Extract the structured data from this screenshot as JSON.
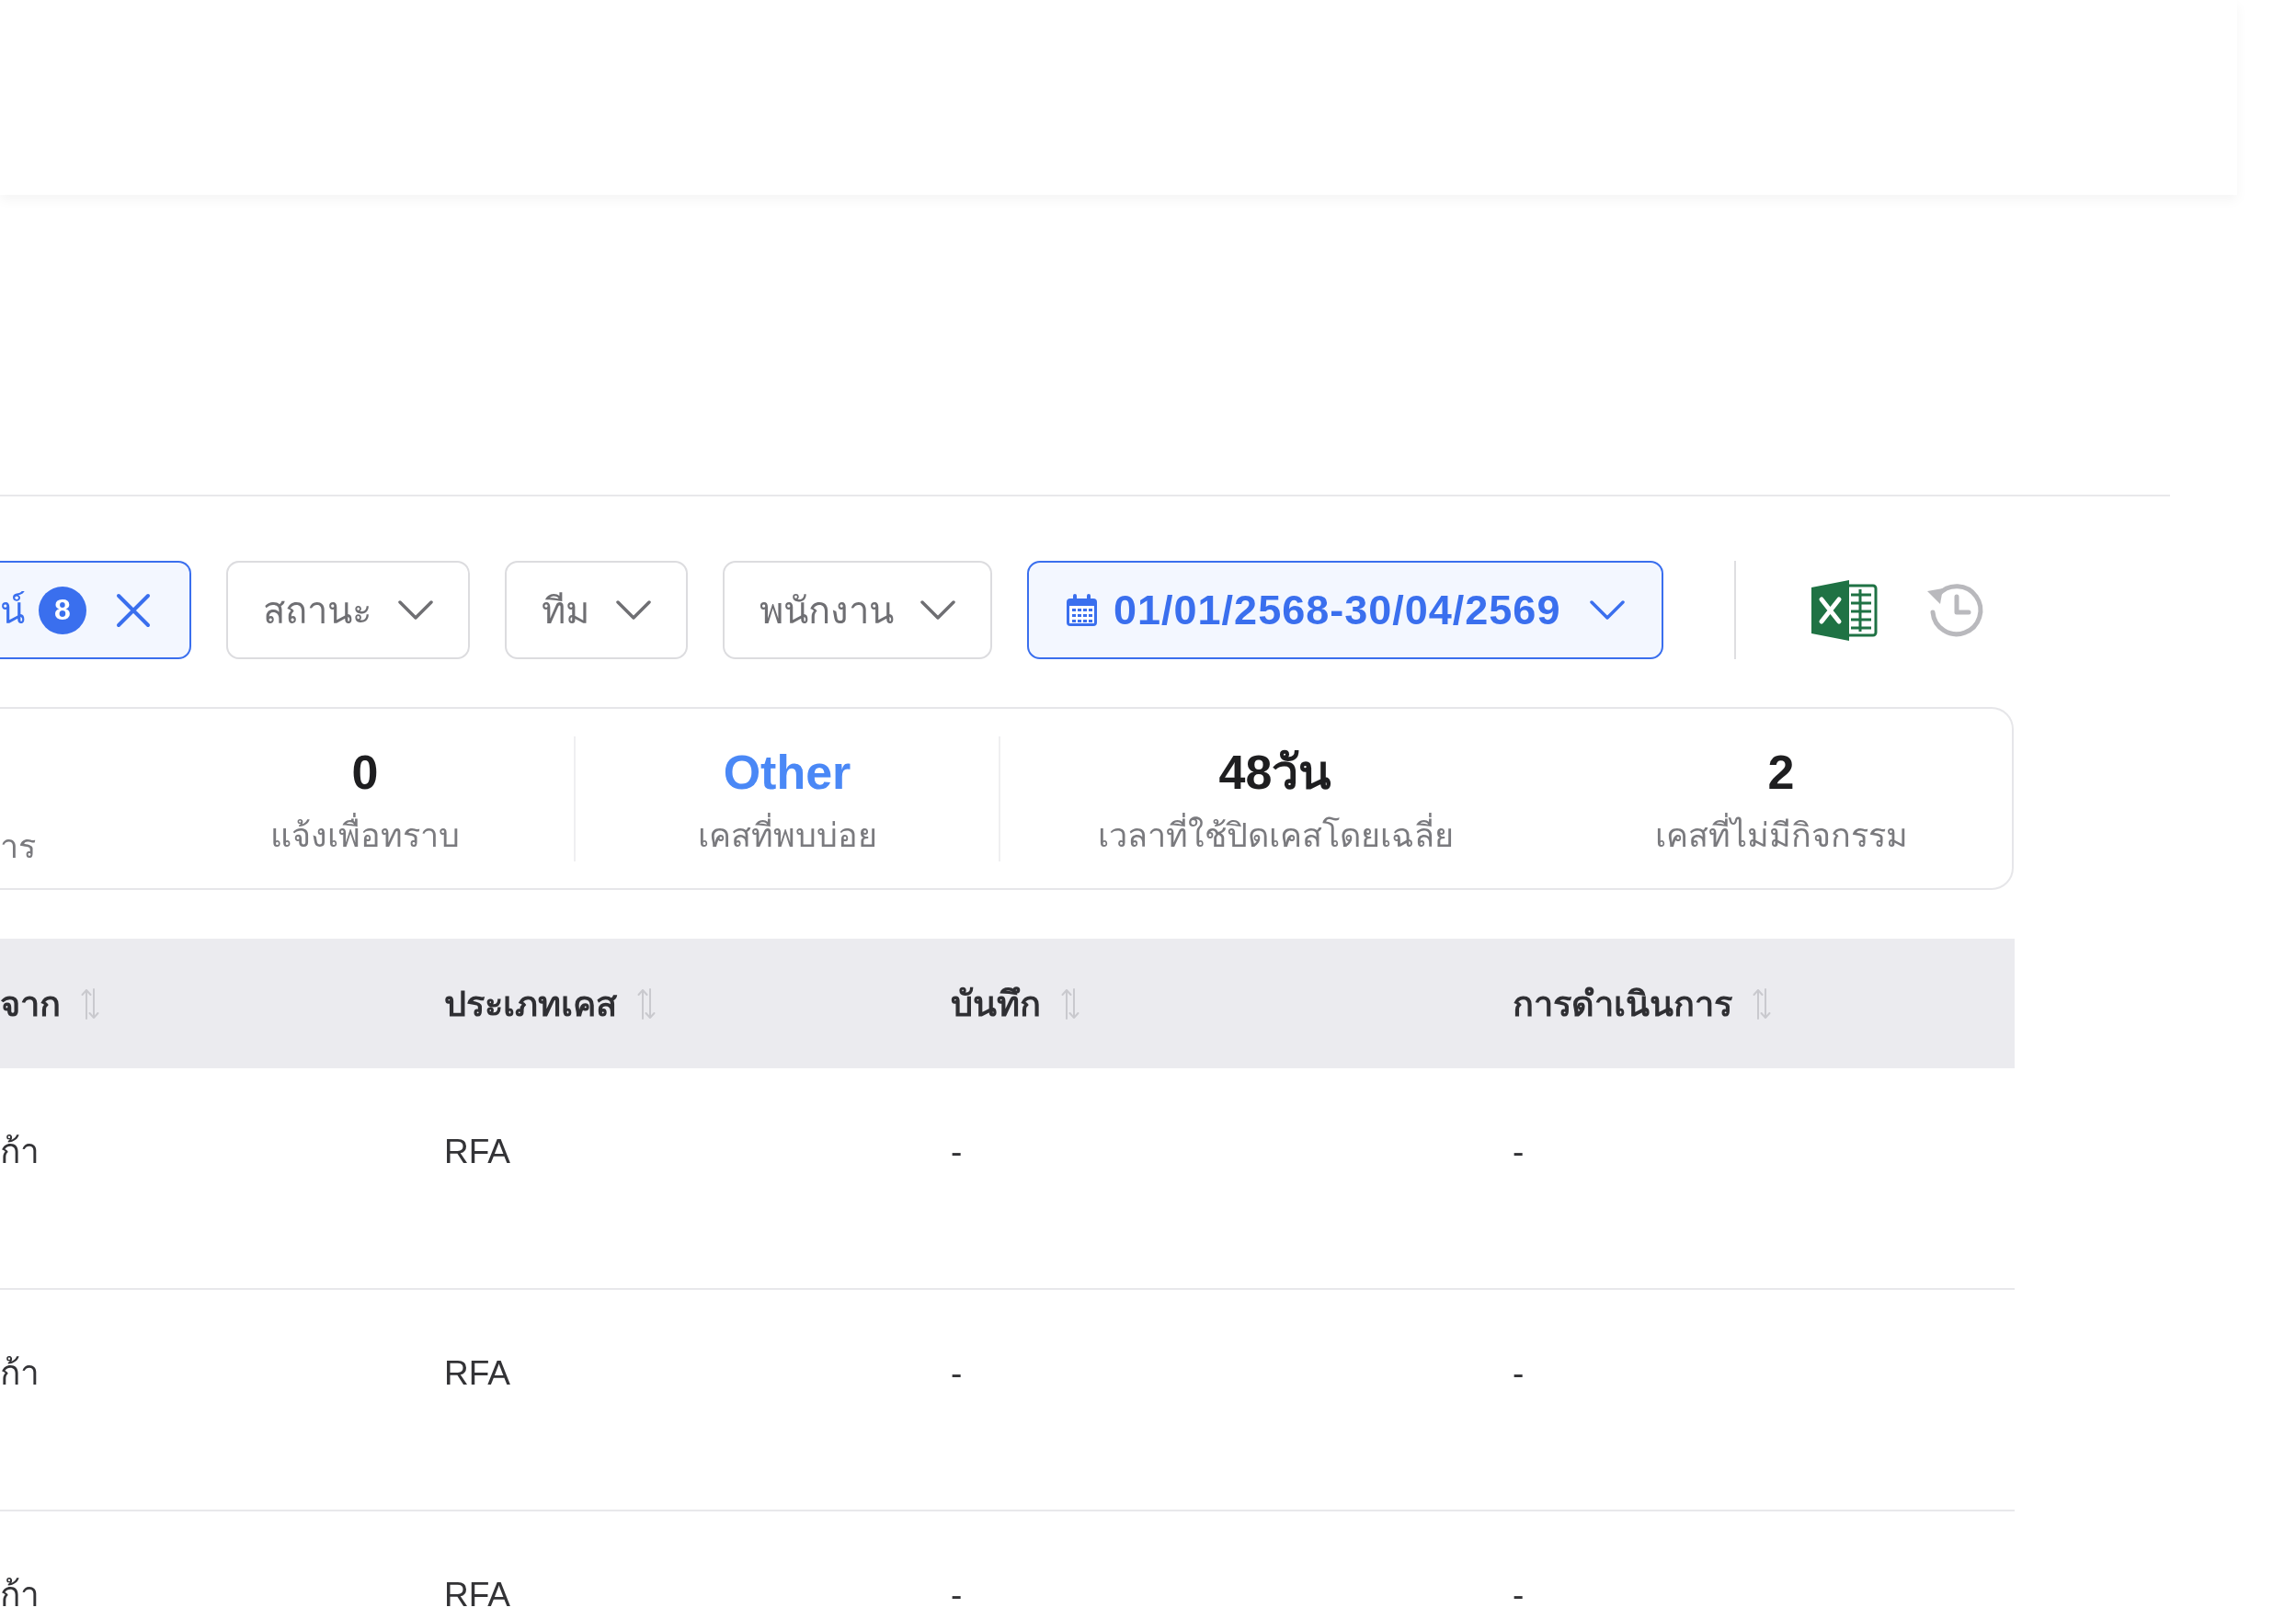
{
  "filter_bar": {
    "filters": [
      {
        "kind": "tag",
        "label": "น์",
        "count": "8",
        "active": true
      },
      {
        "kind": "dropdown",
        "label": "สถานะ",
        "active": false
      },
      {
        "kind": "dropdown",
        "label": "ทีม",
        "active": false
      },
      {
        "kind": "dropdown",
        "label": "พนักงาน",
        "active": false
      },
      {
        "kind": "date",
        "label": "01/01/2568-30/04/2569",
        "active": true
      }
    ]
  },
  "summary": {
    "groups": [
      [
        {
          "label": "าร"
        },
        {
          "value": "0",
          "label": "แจ้งเพื่อทราบ",
          "highlighted": false
        }
      ],
      [
        {
          "value": "Other",
          "label": "เคสที่พบบ่อย",
          "highlighted": true
        }
      ],
      [
        {
          "value": "48วัน",
          "label": "เวลาที่ใช้ปิดเคสโดยเฉลี่ย",
          "highlighted": false
        },
        {
          "value": "2",
          "label": "เคสที่ไม่มีกิจกรรม",
          "highlighted": false
        }
      ]
    ]
  },
  "table": {
    "columns": [
      {
        "label": "จาก",
        "sortable": true
      },
      {
        "label": "ประเภทเคส",
        "sortable": true
      },
      {
        "label": "บันทึก",
        "sortable": true
      },
      {
        "label": "การดำเนินการ",
        "sortable": true
      }
    ],
    "rows": [
      [
        "ก้า",
        "RFA",
        "-",
        "-"
      ],
      [
        "ก้า",
        "RFA",
        "-",
        "-"
      ],
      [
        "ก้า",
        "RFA",
        "-",
        "-"
      ]
    ]
  }
}
